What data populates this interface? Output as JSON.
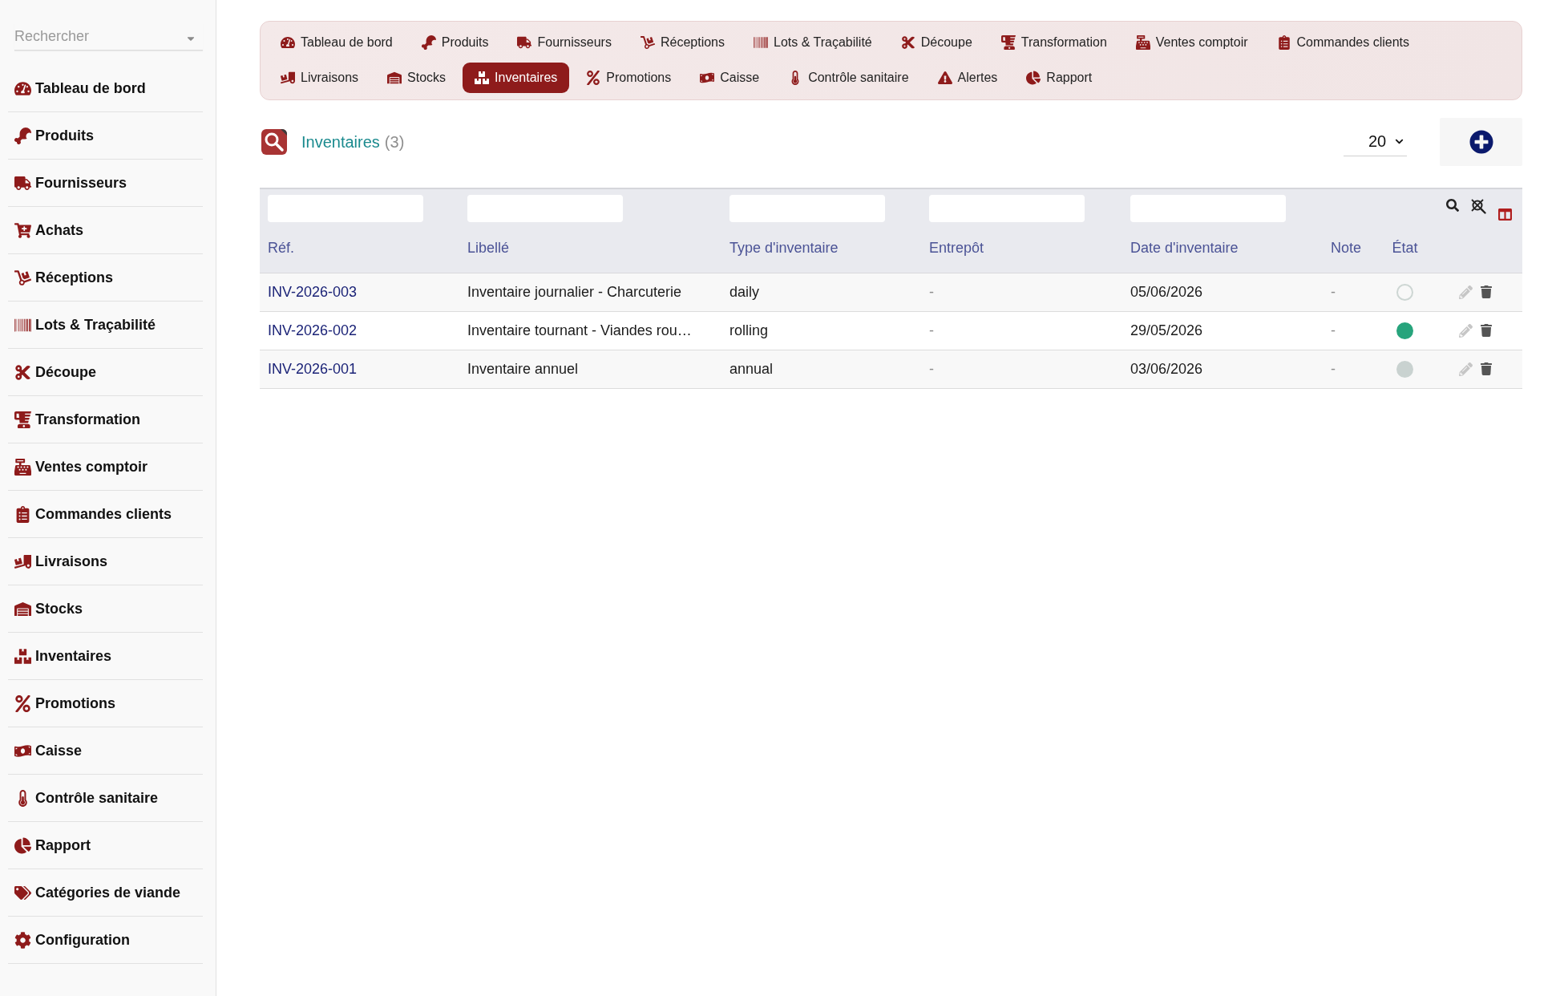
{
  "sidebar": {
    "search": {
      "placeholder": "Rechercher"
    },
    "items": [
      {
        "label": "Tableau de bord"
      },
      {
        "label": "Produits"
      },
      {
        "label": "Fournisseurs"
      },
      {
        "label": "Achats"
      },
      {
        "label": "Réceptions"
      },
      {
        "label": "Lots & Traçabilité"
      },
      {
        "label": "Découpe"
      },
      {
        "label": "Transformation"
      },
      {
        "label": "Ventes comptoir"
      },
      {
        "label": "Commandes clients"
      },
      {
        "label": "Livraisons"
      },
      {
        "label": "Stocks"
      },
      {
        "label": "Inventaires"
      },
      {
        "label": "Promotions"
      },
      {
        "label": "Caisse"
      },
      {
        "label": "Contrôle sanitaire"
      },
      {
        "label": "Rapport"
      },
      {
        "label": "Catégories de viande"
      },
      {
        "label": "Configuration"
      }
    ]
  },
  "nav": {
    "items": [
      {
        "label": "Tableau de bord",
        "selected": false
      },
      {
        "label": "Produits",
        "selected": false
      },
      {
        "label": "Fournisseurs",
        "selected": false
      },
      {
        "label": "Réceptions",
        "selected": false
      },
      {
        "label": "Lots & Traçabilité",
        "selected": false
      },
      {
        "label": "Découpe",
        "selected": false
      },
      {
        "label": "Transformation",
        "selected": false
      },
      {
        "label": "Ventes comptoir",
        "selected": false
      },
      {
        "label": "Commandes clients",
        "selected": false
      },
      {
        "label": "Livraisons",
        "selected": false
      },
      {
        "label": "Stocks",
        "selected": false
      },
      {
        "label": "Inventaires",
        "selected": true
      },
      {
        "label": "Promotions",
        "selected": false
      },
      {
        "label": "Caisse",
        "selected": false
      },
      {
        "label": "Contrôle sanitaire",
        "selected": false
      },
      {
        "label": "Alertes",
        "selected": false
      },
      {
        "label": "Rapport",
        "selected": false
      }
    ]
  },
  "page_header": {
    "title": "Inventaires",
    "count": "(3)",
    "page_size": "20"
  },
  "table": {
    "columns": [
      {
        "label": "Réf.",
        "filter": true
      },
      {
        "label": "Libellé",
        "filter": true
      },
      {
        "label": "Type d'inventaire",
        "filter": true
      },
      {
        "label": "Entrepôt",
        "filter": true
      },
      {
        "label": "Date d'inventaire",
        "filter": true
      },
      {
        "label": "Note",
        "filter": false
      },
      {
        "label": "État",
        "filter": false
      }
    ],
    "rows": [
      {
        "ref": "INV-2026-003",
        "label": "Inventaire journalier - Charcuterie",
        "type": "daily",
        "warehouse": "-",
        "date": "05/06/2026",
        "note": "-",
        "status": {
          "kind": "ring",
          "color": "#cdd6d3"
        }
      },
      {
        "ref": "INV-2026-002",
        "label": "Inventaire tournant - Viandes rou…",
        "type": "rolling",
        "warehouse": "-",
        "date": "29/05/2026",
        "note": "-",
        "status": {
          "kind": "dot",
          "color": "#27a47c"
        }
      },
      {
        "ref": "INV-2026-001",
        "label": "Inventaire annuel",
        "type": "annual",
        "warehouse": "-",
        "date": "03/06/2026",
        "note": "-",
        "status": {
          "kind": "dot",
          "color": "#c9d2d0"
        }
      }
    ]
  }
}
